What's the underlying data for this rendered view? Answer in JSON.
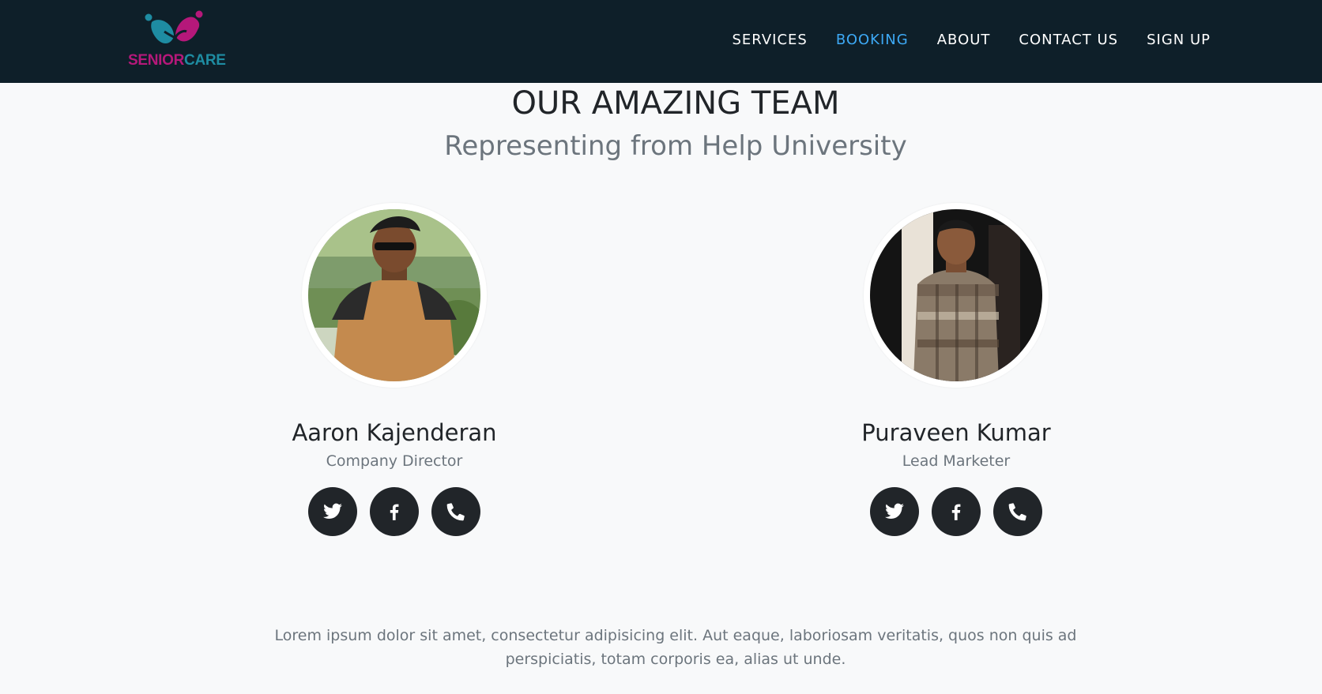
{
  "brand": {
    "part1": "SENIOR",
    "part2": "CARE",
    "colors": {
      "magenta": "#b5187a",
      "teal": "#1e8ca2"
    }
  },
  "nav": {
    "items": [
      {
        "label": "SERVICES"
      },
      {
        "label": "BOOKING",
        "active": true
      },
      {
        "label": "ABOUT"
      },
      {
        "label": "CONTACT US"
      },
      {
        "label": "SIGN UP"
      }
    ]
  },
  "colors": {
    "navbar_bg": "#0e1f29",
    "active_link": "#3da9f5",
    "page_bg": "#f8f9fa",
    "social_bg": "#212529"
  },
  "team": {
    "title": "OUR AMAZING TEAM",
    "subtitle": "Representing from Help University",
    "members": [
      {
        "name": "Aaron Kajenderan",
        "role": "Company Director",
        "socials": [
          "twitter-icon",
          "facebook-icon",
          "phone-icon"
        ]
      },
      {
        "name": "Puraveen Kumar",
        "role": "Lead Marketer",
        "socials": [
          "twitter-icon",
          "facebook-icon",
          "phone-icon"
        ]
      }
    ],
    "description": "Lorem ipsum dolor sit amet, consectetur adipisicing elit. Aut eaque, laboriosam veritatis, quos non quis ad perspiciatis, totam corporis ea, alias ut unde."
  }
}
